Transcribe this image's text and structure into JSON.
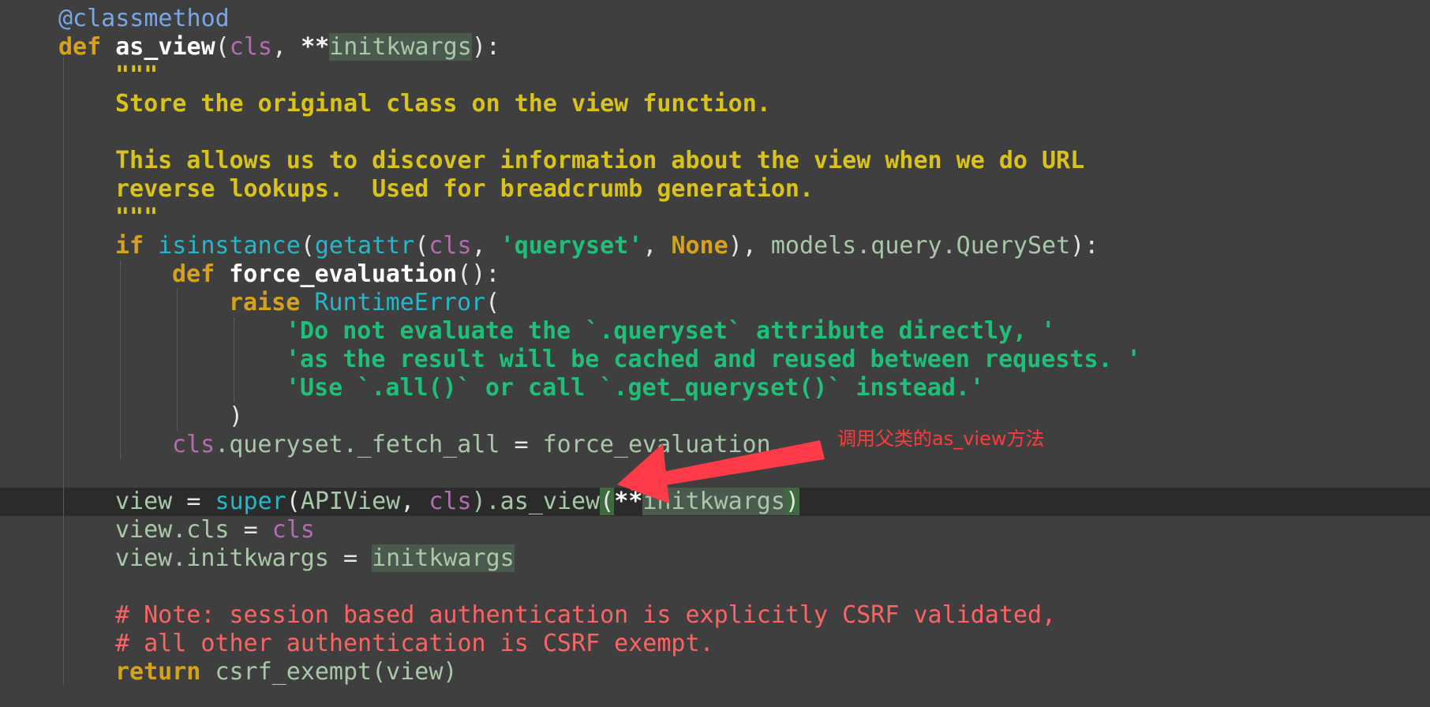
{
  "code": {
    "lines": [
      {
        "tokens": [
          {
            "t": "@classmethod",
            "c": "decorator"
          }
        ]
      },
      {
        "tokens": [
          {
            "t": "def ",
            "c": "keyword"
          },
          {
            "t": "as_view",
            "c": "fn"
          },
          {
            "t": "(",
            "c": "paren"
          },
          {
            "t": "cls",
            "c": "cls"
          },
          {
            "t": ", ",
            "c": "op"
          },
          {
            "t": "**",
            "c": "fn"
          },
          {
            "t": "initkwargs",
            "c": "plain",
            "hl": true
          },
          {
            "t": "):",
            "c": "paren"
          }
        ]
      },
      {
        "tokens": [
          {
            "t": "\"\"\"",
            "c": "docstring"
          }
        ]
      },
      {
        "tokens": [
          {
            "t": "Store the original class on the view function.",
            "c": "docstring"
          }
        ]
      },
      {
        "tokens": []
      },
      {
        "tokens": [
          {
            "t": "This allows us to discover information about the view when we do URL",
            "c": "docstring"
          }
        ]
      },
      {
        "tokens": [
          {
            "t": "reverse lookups.  Used for breadcrumb generation.",
            "c": "docstring"
          }
        ]
      },
      {
        "tokens": [
          {
            "t": "\"\"\"",
            "c": "docstring"
          }
        ]
      },
      {
        "tokens": [
          {
            "t": "if ",
            "c": "keyword"
          },
          {
            "t": "isinstance",
            "c": "builtin"
          },
          {
            "t": "(",
            "c": "paren"
          },
          {
            "t": "getattr",
            "c": "builtin"
          },
          {
            "t": "(",
            "c": "paren"
          },
          {
            "t": "cls",
            "c": "cls"
          },
          {
            "t": ", ",
            "c": "op"
          },
          {
            "t": "'queryset'",
            "c": "string"
          },
          {
            "t": ", ",
            "c": "op"
          },
          {
            "t": "None",
            "c": "const"
          },
          {
            "t": "), ",
            "c": "paren"
          },
          {
            "t": "models.query.QuerySet",
            "c": "plain"
          },
          {
            "t": "):",
            "c": "paren"
          }
        ]
      },
      {
        "tokens": [
          {
            "t": "def ",
            "c": "keyword"
          },
          {
            "t": "force_evaluation",
            "c": "fn"
          },
          {
            "t": "():",
            "c": "paren"
          }
        ]
      },
      {
        "tokens": [
          {
            "t": "raise ",
            "c": "keyword"
          },
          {
            "t": "RuntimeError",
            "c": "builtin"
          },
          {
            "t": "(",
            "c": "paren"
          }
        ]
      },
      {
        "tokens": [
          {
            "t": "'Do not evaluate the `.queryset` attribute directly, '",
            "c": "string"
          }
        ]
      },
      {
        "tokens": [
          {
            "t": "'as the result will be cached and reused between requests. '",
            "c": "string"
          }
        ]
      },
      {
        "tokens": [
          {
            "t": "'Use `.all()` or call `.get_queryset()` instead.'",
            "c": "string"
          }
        ]
      },
      {
        "tokens": [
          {
            "t": ")",
            "c": "paren"
          }
        ]
      },
      {
        "tokens": [
          {
            "t": "cls",
            "c": "cls"
          },
          {
            "t": ".queryset._fetch_all ",
            "c": "plain"
          },
          {
            "t": "= ",
            "c": "op"
          },
          {
            "t": "force_evaluation",
            "c": "plain"
          }
        ]
      },
      {
        "tokens": []
      },
      {
        "tokens": [
          {
            "t": "view ",
            "c": "plain"
          },
          {
            "t": "= ",
            "c": "op"
          },
          {
            "t": "super",
            "c": "builtin"
          },
          {
            "t": "(",
            "c": "paren"
          },
          {
            "t": "APIView",
            "c": "plain"
          },
          {
            "t": ", ",
            "c": "op"
          },
          {
            "t": "cls",
            "c": "cls"
          },
          {
            "t": ").as_view",
            "c": "plain"
          },
          {
            "t": "(",
            "c": "paren",
            "match": true
          },
          {
            "t": "**",
            "c": "fn"
          },
          {
            "t": "initkwargs",
            "c": "plain",
            "hl": true
          },
          {
            "t": ")",
            "c": "paren",
            "match": true
          }
        ]
      },
      {
        "tokens": [
          {
            "t": "view.cls ",
            "c": "plain"
          },
          {
            "t": "= ",
            "c": "op"
          },
          {
            "t": "cls",
            "c": "cls"
          }
        ]
      },
      {
        "tokens": [
          {
            "t": "view.initkwargs ",
            "c": "plain"
          },
          {
            "t": "= ",
            "c": "op"
          },
          {
            "t": "initkwargs",
            "c": "plain",
            "hl": true
          }
        ]
      },
      {
        "tokens": []
      },
      {
        "tokens": [
          {
            "t": "# Note: session based authentication is explicitly CSRF validated,",
            "c": "comment"
          }
        ]
      },
      {
        "tokens": [
          {
            "t": "# all other authentication is CSRF exempt.",
            "c": "comment"
          }
        ]
      },
      {
        "tokens": [
          {
            "t": "return ",
            "c": "keyword"
          },
          {
            "t": "csrf_exempt",
            "c": "plain"
          },
          {
            "t": "(view)",
            "c": "plain"
          }
        ]
      }
    ]
  },
  "annotation": {
    "text": "调用父类的as_view方法",
    "color": "#ff3b3b"
  },
  "colors": {
    "background": "#3f3f3f",
    "current_line": "#2b2b2b",
    "keyword": "#d6a21c",
    "docstring": "#d9c21c",
    "string": "#1fbf7a",
    "comment": "#ff6464",
    "builtin": "#22b8c9",
    "cls": "#b36cb0",
    "decorator": "#7aa6e8"
  }
}
